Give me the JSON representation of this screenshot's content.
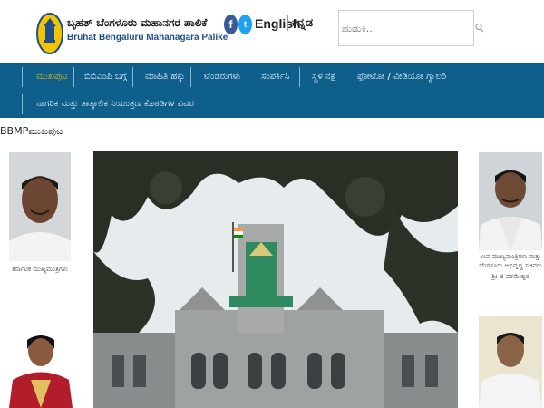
{
  "header": {
    "logo_kn": "ಬೃಹತ್ ಬೆಂಗಳೂರು ಮಹಾನಗರ ಪಾಲಿಕೆ",
    "logo_en": "Bruhat Bengaluru Mahanagara Palike",
    "facebook_glyph": "f",
    "twitter_glyph": "t",
    "lang_english": "English",
    "lang_kannada": "ಕನ್ನಡ",
    "search_placeholder": "ಹುಡುಕಿ..."
  },
  "nav": {
    "row1": [
      "ಮುಖಪುಟ",
      "ಬಿಬಿಎಂಪಿ ಬಗ್ಗೆ",
      "ಮಾಹಿತಿ ಹಕ್ಕು",
      "ಟೆಂಡರುಗಳು",
      "ಸಂಪರ್ಕಿಸಿ",
      "ಸ್ಥಳ ನಕ್ಷೆ",
      "ಫೋಟೋ / ವೀಡಿಯೋ ಗ್ಯಾಲರಿ"
    ],
    "row2": [
      "ನಾಗರಿಕ ಮತ್ತು ತಾತ್ಕಾಲಿಕ ನಿಯಂತ್ರಣ ಕೊಠಡಿಗಳ ವಿವರ"
    ]
  },
  "breadcrumb": "BBMPಮುಖಪುಟ",
  "portraits": {
    "left_top_caption": "ಕರ್ನಾಟಕ ಮುಖ್ಯಮಂತ್ರಿಗಳು",
    "right_top_caption": "ಉಪ ಮುಖ್ಯಮಂತ್ರಿಗಳು ಮತ್ತು",
    "right_top_caption2": "ಬೆಂಗಳೂರು ಅಭಿವೃದ್ಧಿ ಸಚಿವರು",
    "right_top_caption3": "ಶ್ರೀ ಜಿ ಪರಮೇಶ್ವರ"
  },
  "colors": {
    "nav_bg": "#0f5f8d",
    "nav_active": "#f5c400",
    "logo_en": "#1f4e8c"
  }
}
